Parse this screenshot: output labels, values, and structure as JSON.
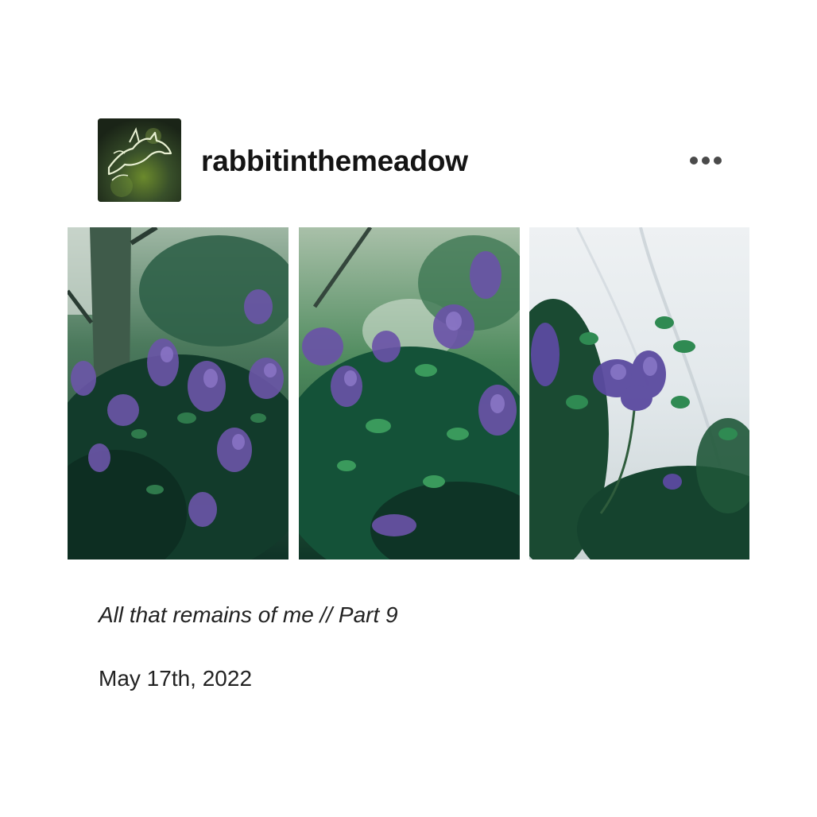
{
  "post": {
    "username": "rabbitinthemeadow",
    "avatar_text": "Rabbit in the Meadow",
    "more_icon": "more-horizontal-icon",
    "photos": [
      {
        "subject": "lilac bush with tree trunk"
      },
      {
        "subject": "lilac bush"
      },
      {
        "subject": "lilac sprig against pale sky"
      }
    ],
    "caption": "All that remains of me // Part 9",
    "date": "May 17th, 2022"
  },
  "colors": {
    "background": "#ffffff",
    "text": "#1b1b1b",
    "icon": "#4a4a4a",
    "lilac": "#6a4fa6",
    "leaf": "#1f5a3a"
  }
}
